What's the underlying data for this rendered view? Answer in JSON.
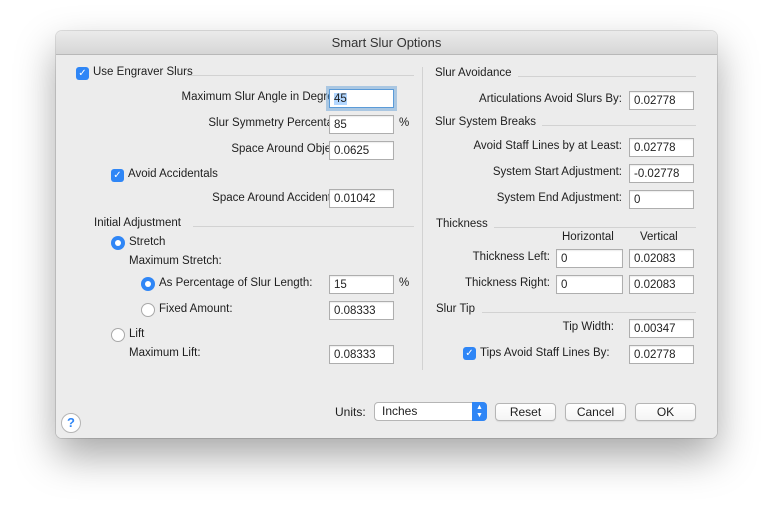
{
  "window": {
    "title": "Smart Slur Options"
  },
  "left": {
    "use_engraver_slurs": {
      "label": "Use Engraver Slurs",
      "checked": true
    },
    "max_slur_angle": {
      "label": "Maximum Slur Angle in Degrees:",
      "value": "45"
    },
    "slur_symmetry": {
      "label": "Slur Symmetry Percentage:",
      "value": "85",
      "unit": "%"
    },
    "space_around_objects": {
      "label": "Space Around Objects:",
      "value": "0.0625"
    },
    "avoid_accidentals": {
      "label": "Avoid Accidentals",
      "checked": true
    },
    "space_around_accidentals": {
      "label": "Space Around Accidentals:",
      "value": "0.01042"
    },
    "initial_adjustment": {
      "heading": "Initial Adjustment",
      "stretch": {
        "label": "Stretch",
        "selected": true
      },
      "maximum_stretch_label": "Maximum Stretch:",
      "as_percentage": {
        "label": "As Percentage of Slur Length:",
        "value": "15",
        "unit": "%",
        "selected": true
      },
      "fixed_amount": {
        "label": "Fixed Amount:",
        "value": "0.08333",
        "selected": false
      },
      "lift": {
        "label": "Lift",
        "selected": false
      },
      "maximum_lift": {
        "label": "Maximum Lift:",
        "value": "0.08333"
      }
    }
  },
  "right": {
    "slur_avoidance": {
      "heading": "Slur Avoidance",
      "articulations": {
        "label": "Articulations Avoid Slurs By:",
        "value": "0.02778"
      }
    },
    "slur_system_breaks": {
      "heading": "Slur System Breaks",
      "avoid_staff_lines": {
        "label": "Avoid Staff Lines by at Least:",
        "value": "0.02778"
      },
      "system_start": {
        "label": "System Start Adjustment:",
        "value": "-0.02778"
      },
      "system_end": {
        "label": "System End Adjustment:",
        "value": "0"
      }
    },
    "thickness": {
      "heading": "Thickness",
      "col_horizontal": "Horizontal",
      "col_vertical": "Vertical",
      "left": {
        "label": "Thickness Left:",
        "horizontal": "0",
        "vertical": "0.02083"
      },
      "right": {
        "label": "Thickness Right:",
        "horizontal": "0",
        "vertical": "0.02083"
      }
    },
    "slur_tip": {
      "heading": "Slur Tip",
      "tip_width": {
        "label": "Tip Width:",
        "value": "0.00347"
      },
      "tips_avoid": {
        "label": "Tips Avoid Staff Lines By:",
        "value": "0.02778",
        "checked": true
      }
    }
  },
  "footer": {
    "units_label": "Units:",
    "units_value": "Inches",
    "reset": "Reset",
    "cancel": "Cancel",
    "ok": "OK",
    "help": "?"
  },
  "colors": {
    "accent": "#2f86f6",
    "window_bg": "#ececec"
  }
}
